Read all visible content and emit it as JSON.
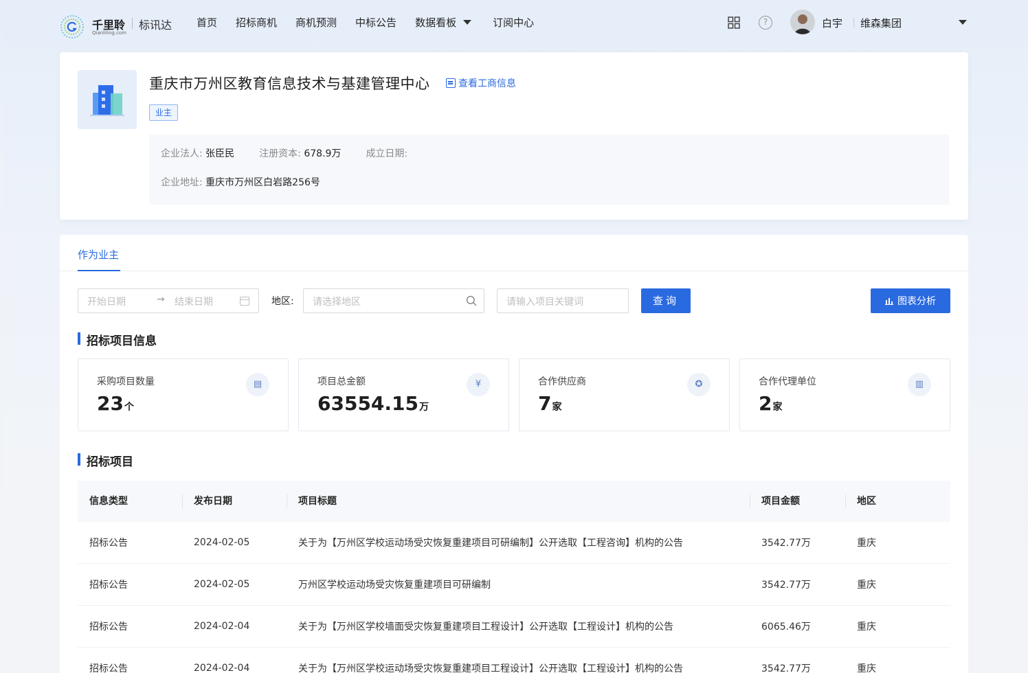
{
  "brand": {
    "name_cn": "千里聆",
    "name_en": "Qianliling.com",
    "product": "标讯达"
  },
  "nav": {
    "items": [
      {
        "label": "首页"
      },
      {
        "label": "招标商机"
      },
      {
        "label": "商机预测"
      },
      {
        "label": "中标公告"
      },
      {
        "label": "数据看板"
      },
      {
        "label": "订阅中心"
      }
    ]
  },
  "user": {
    "name": "白宇",
    "org": "维森集团"
  },
  "company": {
    "name": "重庆市万州区教育信息技术与基建管理中心",
    "biz_link": "查看工商信息",
    "role_tag": "业主",
    "legal_rep_label": "企业法人:",
    "legal_rep": "张臣民",
    "capital_label": "注册资本:",
    "capital": "678.9万",
    "founded_label": "成立日期:",
    "founded": "",
    "address_label": "企业地址:",
    "address": "重庆市万州区白岩路256号"
  },
  "tabs": [
    {
      "label": "作为业主",
      "active": true
    }
  ],
  "filters": {
    "start_date_placeholder": "开始日期",
    "end_date_placeholder": "结束日期",
    "arrow": "→",
    "region_label": "地区:",
    "region_placeholder": "请选择地区",
    "keyword_placeholder": "请输入项目关键词",
    "query_button": "查询",
    "chart_button": "图表分析"
  },
  "sections": {
    "info_title": "招标项目信息",
    "projects_title": "招标项目"
  },
  "stats": [
    {
      "label": "采购项目数量",
      "value": "23",
      "unit": "个",
      "icon": "document-icon"
    },
    {
      "label": "项目总金额",
      "value": "63554.15",
      "unit": "万",
      "icon": "yuan-icon"
    },
    {
      "label": "合作供应商",
      "value": "7",
      "unit": "家",
      "icon": "badge-icon"
    },
    {
      "label": "合作代理单位",
      "value": "2",
      "unit": "家",
      "icon": "building-icon"
    }
  ],
  "table": {
    "columns": [
      "信息类型",
      "发布日期",
      "项目标题",
      "项目金额",
      "地区"
    ],
    "rows": [
      [
        "招标公告",
        "2024-02-05",
        "关于为【万州区学校运动场受灾恢复重建项目可研编制】公开选取【工程咨询】机构的公告",
        "3542.77万",
        "重庆"
      ],
      [
        "招标公告",
        "2024-02-05",
        "万州区学校运动场受灾恢复重建项目可研编制",
        "3542.77万",
        "重庆"
      ],
      [
        "招标公告",
        "2024-02-04",
        "关于为【万州区学校墙面受灾恢复重建项目工程设计】公开选取【工程设计】机构的公告",
        "6065.46万",
        "重庆"
      ],
      [
        "招标公告",
        "2024-02-04",
        "关于为【万州区学校运动场受灾恢复重建项目工程设计】公开选取【工程设计】机构的公告",
        "3542.77万",
        "重庆"
      ]
    ]
  },
  "colors": {
    "primary": "#2a6ae0",
    "text": "#262626",
    "muted": "#8a8a8a"
  }
}
